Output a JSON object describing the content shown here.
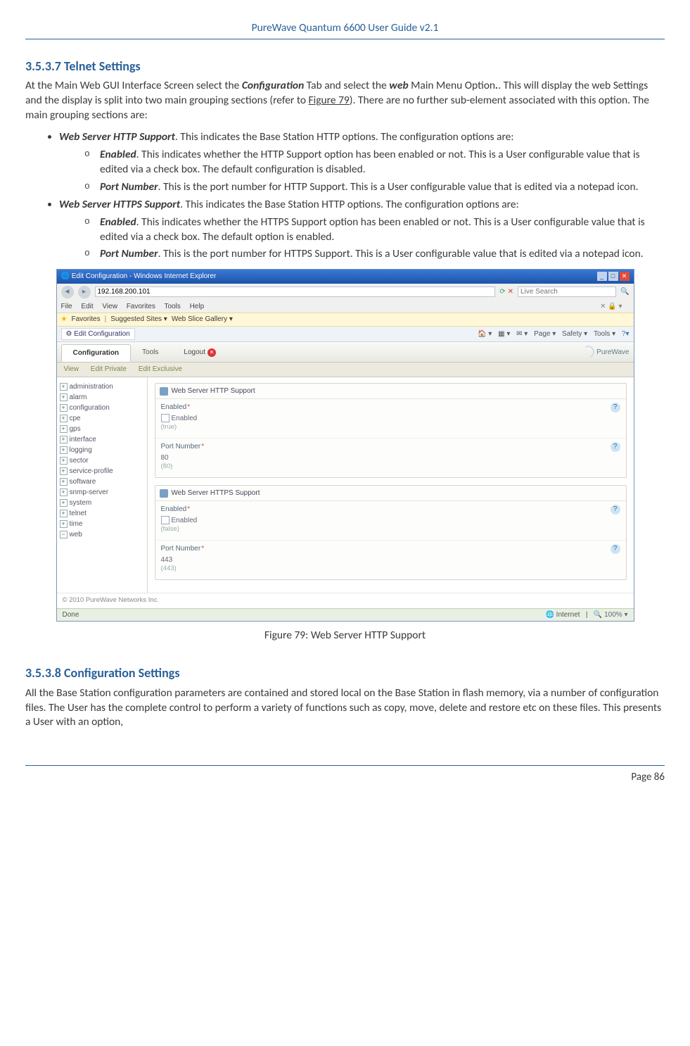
{
  "header": {
    "title": "PureWave Quantum 6600 User Guide v2.1"
  },
  "section1": {
    "number": "3.5.3.7",
    "title": "Telnet Settings",
    "intro_a": "At the Main Web GUI Interface Screen select the ",
    "intro_conf": "Configuration",
    "intro_b": " Tab and select the ",
    "intro_web": "web",
    "intro_c": " Main Menu Option",
    "intro_d": ". This will display the web Settings and the display is split into two main grouping sections (refer to ",
    "intro_figref": "Figure 79",
    "intro_e": "). There are no further sub-element associated with this option. The main grouping sections are:"
  },
  "list": {
    "http_head": "Web Server HTTP Support",
    "http_tail": ". This indicates the Base Station HTTP options. The configuration options are:",
    "http_enabled_head": "Enabled",
    "http_enabled_tail": ". This indicates whether the HTTP Support option has been enabled or not. This is a User configurable value that is edited via a check box. The default configuration is disabled.",
    "http_port_head": "Port Number",
    "http_port_tail": ". This is the port number for HTTP Support. This is a User configurable value that is edited via a notepad icon.",
    "https_head": "Web Server HTTPS Support",
    "https_tail": ". This indicates the Base Station HTTP options. The configuration options are:",
    "https_enabled_head": "Enabled",
    "https_enabled_tail": ". This indicates whether the HTTPS Support option has been enabled or not. This is a User configurable value that is edited via a check box. The default option is enabled.",
    "https_port_head": "Port Number",
    "https_port_tail": ". This is the port number for HTTPS Support. This is a User configurable value that is edited via a notepad icon."
  },
  "figure": {
    "caption": "Figure 79: Web Server HTTP Support"
  },
  "section2": {
    "number": "3.5.3.8",
    "title": "Configuration Settings",
    "para": "All the Base Station configuration parameters are contained and stored local on the Base Station in flash memory, via a number of configuration files. The User has the complete control to perform a variety of functions such as copy, move, delete and restore etc on these files. This presents a User with an option,"
  },
  "footer": {
    "page": "Page 86"
  },
  "shot": {
    "window_title": "Edit Configuration - Windows Internet Explorer",
    "url": "192.168.200.101",
    "search_hint": "Live Search",
    "menu": [
      "File",
      "Edit",
      "View",
      "Favorites",
      "Tools",
      "Help"
    ],
    "fav_label": "Favorites",
    "fav_sites": "Suggested Sites ▾",
    "fav_gallery": "Web Slice Gallery ▾",
    "tab_label": "Edit Configuration",
    "tool_items": [
      "Page ▾",
      "Safety ▾",
      "Tools ▾"
    ],
    "tabs": {
      "conf": "Configuration",
      "tools": "Tools",
      "logout": "Logout"
    },
    "brand": "PureWave",
    "subtabs": [
      "View",
      "Edit Private",
      "Edit Exclusive"
    ],
    "tree": [
      "administration",
      "alarm",
      "configuration",
      "cpe",
      "gps",
      "interface",
      "logging",
      "sector",
      "service-profile",
      "software",
      "snmp-server",
      "system",
      "telnet",
      "time",
      "web"
    ],
    "panel_http": {
      "title": "Web Server HTTP Support",
      "enabled_label": "Enabled",
      "enabled_chklabel": "Enabled",
      "enabled_hint": "(true)",
      "port_label": "Port Number",
      "port_value": "80",
      "port_hint": "(80)"
    },
    "panel_https": {
      "title": "Web Server HTTPS Support",
      "enabled_label": "Enabled",
      "enabled_chklabel": "Enabled",
      "enabled_hint": "(false)",
      "port_label": "Port Number",
      "port_value": "443",
      "port_hint": "(443)"
    },
    "copyright": "© 2010 PureWave Networks Inc.",
    "status_done": "Done",
    "status_zone": "Internet",
    "status_zoom": "100%"
  }
}
